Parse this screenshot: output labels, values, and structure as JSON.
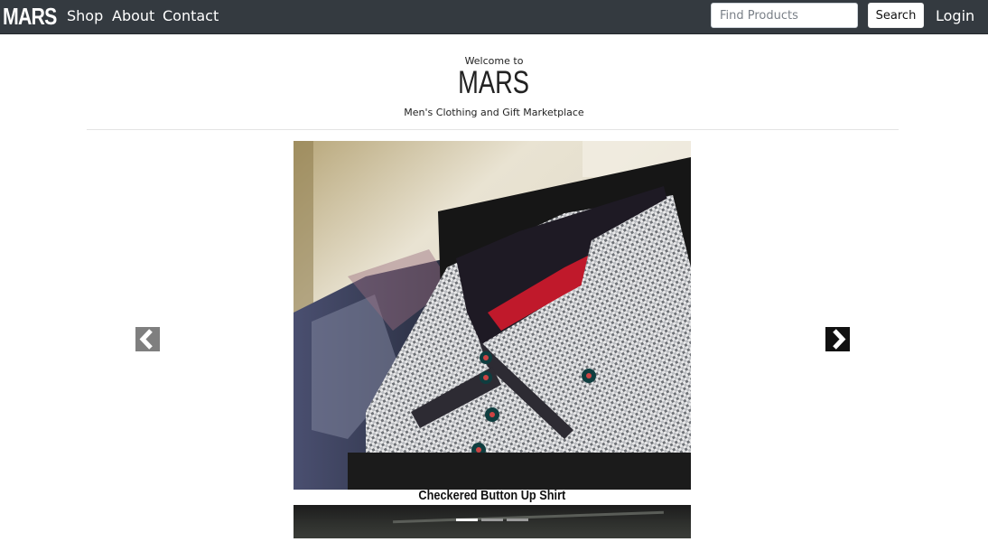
{
  "navbar": {
    "brand": "MARS",
    "links": {
      "shop": "Shop",
      "about": "About",
      "contact": "Contact"
    },
    "search": {
      "placeholder": "Find Products",
      "value": "",
      "button_label": "Search"
    },
    "login": "Login",
    "colors": {
      "background": "#343a40",
      "text": "#ffffff"
    }
  },
  "header": {
    "welcome": "Welcome to",
    "title": "MARS",
    "tagline": "Men's Clothing and Gift Marketplace"
  },
  "carousel": {
    "caption": "Checkered Button Up Shirt",
    "image_icon": "shirt-photo",
    "slide_count": 3,
    "active_slide": 1,
    "prev_icon": "chevron-left-icon",
    "next_icon": "chevron-right-icon"
  }
}
